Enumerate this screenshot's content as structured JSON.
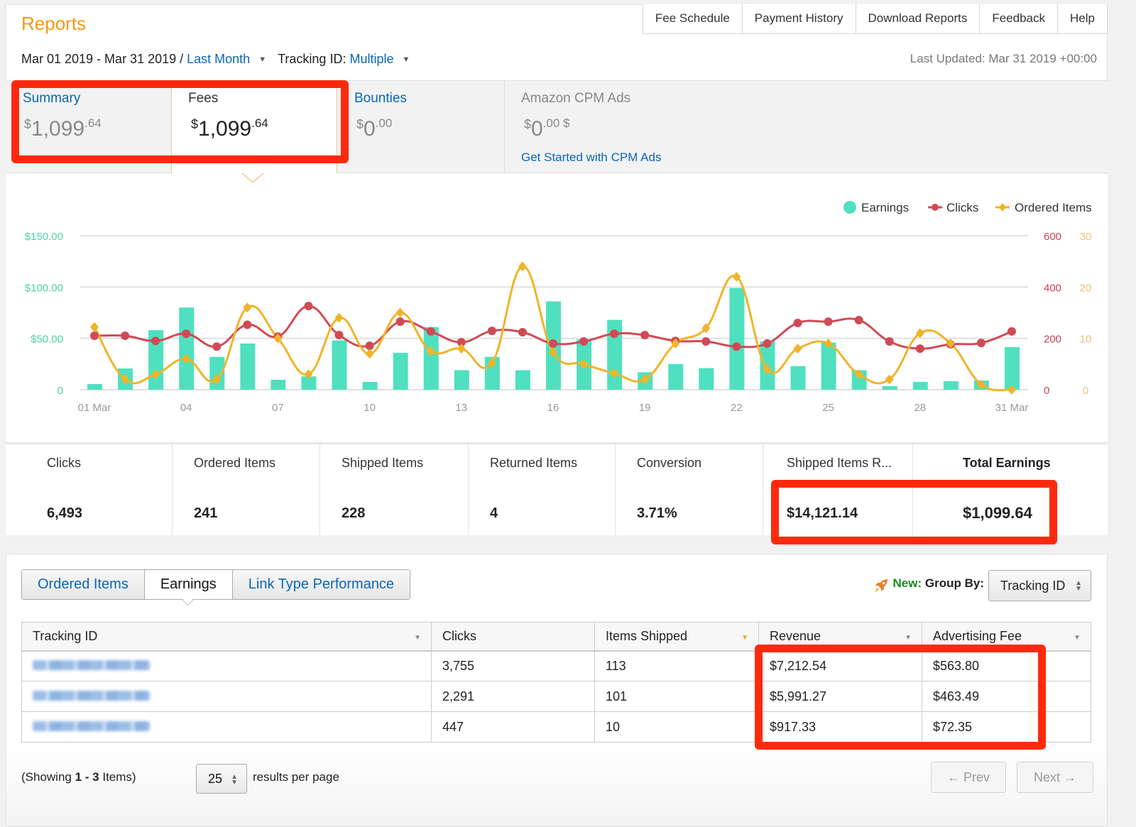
{
  "header": {
    "title": "Reports",
    "nav": [
      "Fee Schedule",
      "Payment History",
      "Download Reports",
      "Feedback",
      "Help"
    ],
    "date_range": "Mar 01 2019 - Mar 31 2019 / ",
    "date_preset": "Last Month",
    "tracking_label": "Tracking ID: ",
    "tracking_value": "Multiple",
    "last_updated": "Last Updated: Mar 31 2019 +00:00"
  },
  "cards": {
    "summary": {
      "title": "Summary",
      "currency": "$",
      "whole": "1,099",
      "cents": ".64"
    },
    "fees": {
      "title": "Fees",
      "currency": "$",
      "whole": "1,099",
      "cents": ".64"
    },
    "bounties": {
      "title": "Bounties",
      "currency": "$",
      "whole": "0",
      "cents": ".00"
    },
    "cpm": {
      "title": "Amazon CPM Ads",
      "currency": "$",
      "whole": "0",
      "cents": ".00 $",
      "link": "Get Started with CPM Ads"
    }
  },
  "chart_data": {
    "type": "bar",
    "title": "",
    "categories": [
      "01 Mar",
      "02",
      "03",
      "04",
      "05",
      "06",
      "07",
      "08",
      "09",
      "10",
      "11",
      "12",
      "13",
      "14",
      "15",
      "16",
      "17",
      "18",
      "19",
      "20",
      "21",
      "22",
      "23",
      "24",
      "25",
      "26",
      "27",
      "28",
      "29",
      "30",
      "31 Mar"
    ],
    "x_tick_labels": [
      "01 Mar",
      "04",
      "07",
      "10",
      "13",
      "16",
      "19",
      "22",
      "25",
      "28",
      "31 Mar"
    ],
    "legend": [
      "Earnings",
      "Clicks",
      "Ordered Items"
    ],
    "legend_position": "top-right",
    "grid": true,
    "series": [
      {
        "name": "Earnings",
        "type": "bar",
        "axis": "left",
        "color": "#4fe0bf",
        "values": [
          5.5,
          20.7,
          58,
          80,
          32,
          45,
          9.7,
          13,
          48,
          7.6,
          36,
          61,
          19,
          32,
          19,
          86,
          49,
          68,
          17,
          25,
          21,
          99,
          47,
          23,
          46,
          19,
          3.5,
          7.6,
          8.3,
          9,
          41.5
        ]
      },
      {
        "name": "Clicks",
        "type": "line",
        "axis": "right1",
        "color": "#d04a55",
        "values": [
          210,
          210,
          190,
          218,
          168,
          253,
          207,
          326,
          213,
          171,
          265,
          227,
          185,
          229,
          224,
          180,
          188,
          218,
          213,
          190,
          188,
          168,
          180,
          260,
          265,
          271,
          188,
          160,
          177,
          182,
          227
        ]
      },
      {
        "name": "Ordered Items",
        "type": "line",
        "axis": "right2",
        "color": "#f0b429",
        "values": [
          12.2,
          2,
          3,
          6,
          2,
          16,
          10,
          3,
          14,
          7,
          15,
          7.5,
          8,
          5.2,
          24,
          7.3,
          5,
          3.2,
          2,
          9,
          12,
          22,
          4,
          8,
          9,
          3,
          2,
          11,
          9,
          1,
          0
        ]
      }
    ],
    "y_left": {
      "ticks": [
        "0",
        "$50.00",
        "$100.00",
        "$150.00"
      ],
      "range": [
        0,
        150
      ],
      "color": "#4fcfa8"
    },
    "y_right1": {
      "ticks": [
        "0",
        "200",
        "400",
        "600"
      ],
      "range": [
        0,
        600
      ],
      "color": "#c94050"
    },
    "y_right2": {
      "ticks": [
        "0",
        "10",
        "20",
        "30"
      ],
      "range": [
        0,
        30
      ],
      "color": "#e8c07a"
    }
  },
  "metrics": [
    {
      "label": "Clicks",
      "value": "6,493"
    },
    {
      "label": "Ordered Items",
      "value": "241"
    },
    {
      "label": "Shipped Items",
      "value": "228"
    },
    {
      "label": "Returned Items",
      "value": "4"
    },
    {
      "label": "Conversion",
      "value": "3.71%"
    },
    {
      "label": "Shipped Items R...",
      "value": "$14,121.14"
    },
    {
      "label": "Total Earnings",
      "value": "$1,099.64"
    }
  ],
  "report_tabs": [
    "Ordered Items",
    "Earnings",
    "Link Type Performance"
  ],
  "group_by": {
    "new_label": "New:",
    "label": " Group By:",
    "value": "Tracking ID"
  },
  "table": {
    "columns": [
      "Tracking ID",
      "Clicks",
      "Items Shipped",
      "Revenue",
      "Advertising Fee"
    ],
    "rows": [
      {
        "tracking_id": "[blurred]",
        "clicks": "3,755",
        "items_shipped": "113",
        "revenue": "$7,212.54",
        "fee": "$563.80"
      },
      {
        "tracking_id": "[blurred]",
        "clicks": "2,291",
        "items_shipped": "101",
        "revenue": "$5,991.27",
        "fee": "$463.49"
      },
      {
        "tracking_id": "[blurred]",
        "clicks": "447",
        "items_shipped": "10",
        "revenue": "$917.33",
        "fee": "$72.35"
      }
    ]
  },
  "footer": {
    "showing_prefix": "(Showing ",
    "showing_range": "1 - 3",
    "showing_suffix": " Items)",
    "per_page": "25",
    "per_page_label": "results per page",
    "prev": "←  Prev",
    "next": "Next  →"
  },
  "colors": {
    "accent_orange": "#f19a12",
    "link_blue": "#0a66b6",
    "annotation_red": "#ff2a0d"
  }
}
